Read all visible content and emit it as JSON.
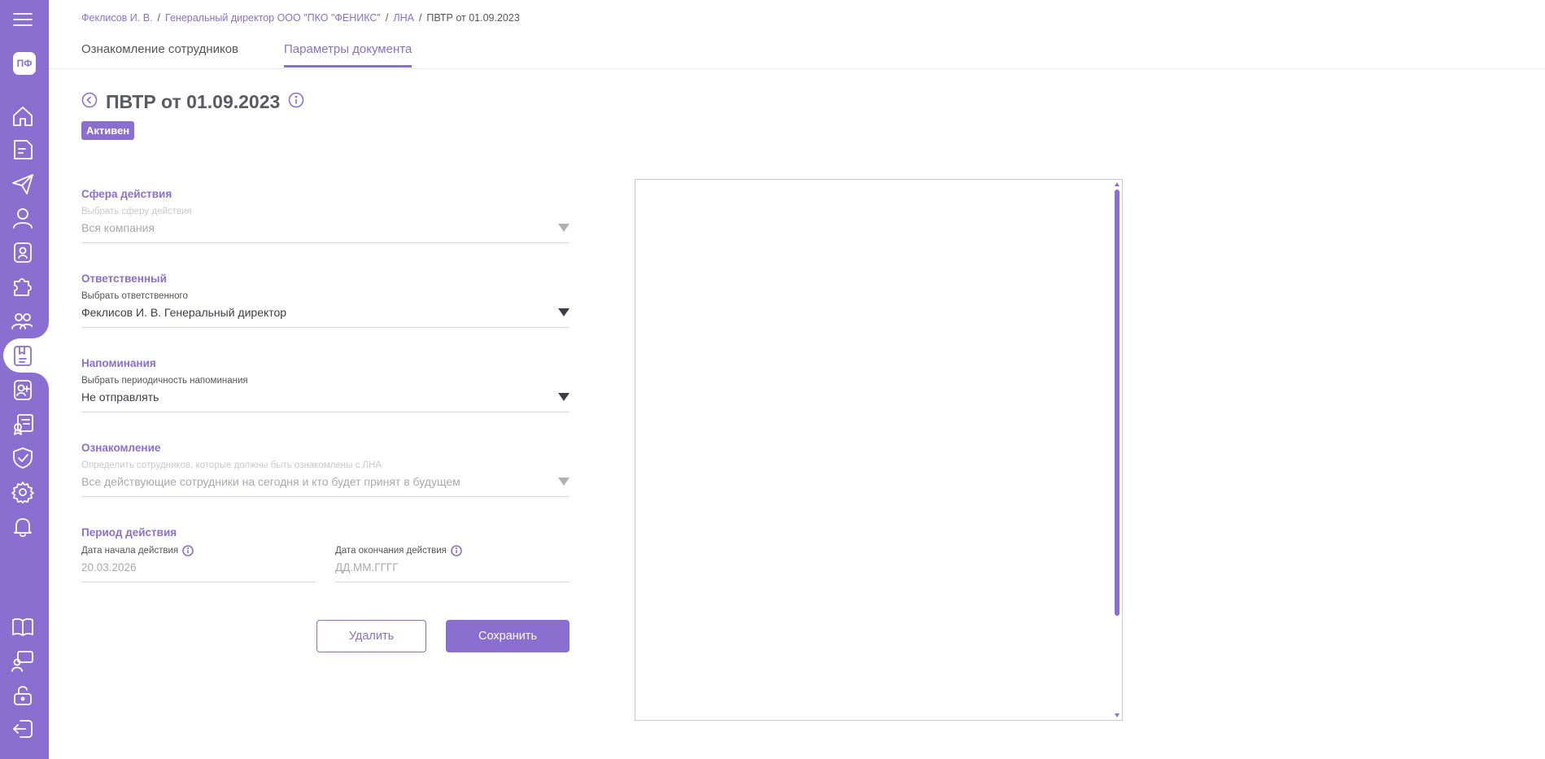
{
  "sidebar": {
    "avatar_initials": "ПФ",
    "icons": [
      "menu-icon",
      "home-icon",
      "document-icon",
      "send-icon",
      "user-icon",
      "employee-badge-icon",
      "puzzle-icon",
      "team-icon",
      "document-review-icon",
      "add-user-icon",
      "certificate-icon",
      "shield-check-icon",
      "gear-icon",
      "bell-icon",
      "book-icon",
      "training-icon",
      "unlock-icon",
      "logout-icon"
    ]
  },
  "breadcrumb": {
    "items": [
      "Феклисов И. В.",
      "Генеральный директор ООО \"ПКО \"ФЕНИКС\"",
      "ЛНА"
    ],
    "current": "ПВТР от 01.09.2023",
    "separator": "/"
  },
  "tabs": [
    {
      "label": "Ознакомление сотрудников",
      "active": false
    },
    {
      "label": "Параметры документа",
      "active": true
    }
  ],
  "header": {
    "title": "ПВТР от 01.09.2023",
    "status": "Активен"
  },
  "form": {
    "scope": {
      "label": "Сфера действия",
      "hint": "Выбрать сферу действия",
      "value": "Вся компания"
    },
    "responsible": {
      "label": "Ответственный",
      "hint": "Выбрать ответственного",
      "value": "Феклисов И. В. Генеральный директор"
    },
    "reminders": {
      "label": "Напоминания",
      "hint": "Выбрать периодичность напоминания",
      "value": "Не отправлять"
    },
    "acquaintance": {
      "label": "Ознакомление",
      "hint": "Определить сотрудников, которые должны быть ознакомлены с ЛНА",
      "value": "Все действующие сотрудники на сегодня и кто будет принят в будущем"
    },
    "period": {
      "label": "Период действия",
      "start_hint": "Дата начала действия",
      "start_value": "20.03.2026",
      "end_hint": "Дата окончания действия",
      "end_placeholder": "ДД.ММ.ГГГГ"
    }
  },
  "actions": {
    "delete_label": "Удалить",
    "save_label": "Сохранить"
  },
  "colors": {
    "accent": "#8a6fd1"
  }
}
